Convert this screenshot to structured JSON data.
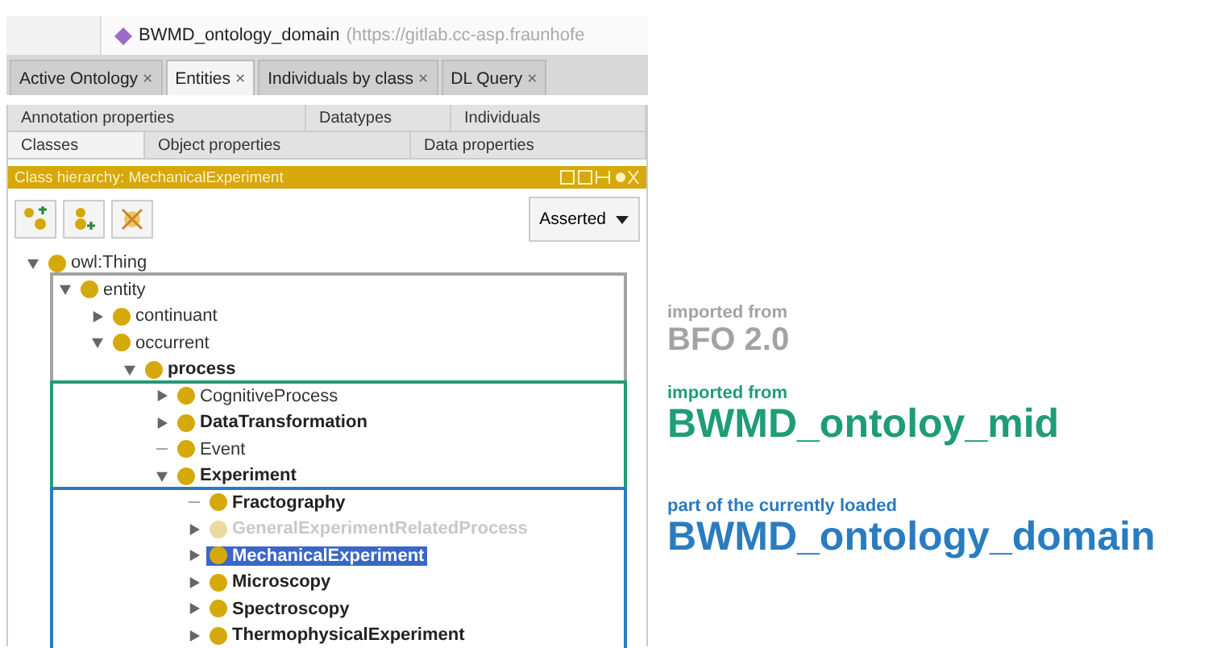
{
  "address_bar": {
    "title": "BWMD_ontology_domain",
    "url": "(https://gitlab.cc-asp.fraunhofe"
  },
  "tabs": [
    {
      "label": "Active Ontology",
      "close": "×",
      "selected": false
    },
    {
      "label": "Entities",
      "close": "×",
      "selected": true
    },
    {
      "label": "Individuals by class",
      "close": "×",
      "selected": false
    },
    {
      "label": "DL Query",
      "close": "×",
      "selected": false
    }
  ],
  "sub_tabs": [
    [
      {
        "label": "Annotation properties",
        "selected": false
      },
      {
        "label": "Datatypes",
        "selected": false
      },
      {
        "label": "Individuals",
        "selected": false
      }
    ],
    [
      {
        "label": "Classes",
        "selected": true
      },
      {
        "label": "Object properties",
        "selected": false
      },
      {
        "label": "Data properties",
        "selected": false
      }
    ]
  ],
  "view_header": {
    "title": "Class hierarchy: MechanicalExperiment"
  },
  "toolbar": {
    "dropdown": "Asserted"
  },
  "tree": [
    {
      "label": "owl:Thing",
      "kind": "branch",
      "expanded": true,
      "bold": false,
      "selected": false,
      "disabled": false,
      "children": [
        {
          "label": "entity",
          "kind": "branch",
          "expanded": true,
          "bold": false,
          "selected": false,
          "disabled": false,
          "children": [
            {
              "label": "continuant",
              "kind": "branch",
              "expanded": false,
              "bold": false,
              "selected": false,
              "disabled": false
            },
            {
              "label": "occurrent",
              "kind": "branch",
              "expanded": true,
              "bold": false,
              "selected": false,
              "disabled": false,
              "children": [
                {
                  "label": "process",
                  "kind": "branch",
                  "expanded": true,
                  "bold": true,
                  "selected": false,
                  "disabled": false,
                  "children": [
                    {
                      "label": "CognitiveProcess",
                      "kind": "branch",
                      "expanded": false,
                      "bold": false,
                      "selected": false,
                      "disabled": false
                    },
                    {
                      "label": "DataTransformation",
                      "kind": "branch",
                      "expanded": false,
                      "bold": true,
                      "selected": false,
                      "disabled": false
                    },
                    {
                      "label": "Event",
                      "kind": "leaf",
                      "bold": false,
                      "selected": false,
                      "disabled": false
                    },
                    {
                      "label": "Experiment",
                      "kind": "branch",
                      "expanded": true,
                      "bold": true,
                      "selected": false,
                      "disabled": false,
                      "children": [
                        {
                          "label": "Fractography",
                          "kind": "leaf",
                          "bold": true,
                          "selected": false,
                          "disabled": false
                        },
                        {
                          "label": "GeneralExperimentRelatedProcess",
                          "kind": "branch",
                          "expanded": false,
                          "bold": true,
                          "selected": false,
                          "disabled": true
                        },
                        {
                          "label": "MechanicalExperiment",
                          "kind": "branch",
                          "expanded": false,
                          "bold": true,
                          "selected": true,
                          "disabled": false
                        },
                        {
                          "label": "Microscopy",
                          "kind": "branch",
                          "expanded": false,
                          "bold": true,
                          "selected": false,
                          "disabled": false
                        },
                        {
                          "label": "Spectroscopy",
                          "kind": "branch",
                          "expanded": false,
                          "bold": true,
                          "selected": false,
                          "disabled": false
                        },
                        {
                          "label": "ThermophysicalExperiment",
                          "kind": "branch",
                          "expanded": false,
                          "bold": true,
                          "selected": false,
                          "disabled": false
                        }
                      ]
                    }
                  ]
                }
              ]
            }
          ]
        }
      ]
    }
  ],
  "annotations": [
    {
      "caption": "imported from",
      "name": "BFO 2.0",
      "color": "#a3a3a3"
    },
    {
      "caption": "imported from",
      "name": "BWMD_ontoloy_mid",
      "color": "#1f9c78"
    },
    {
      "caption": "part of the currently loaded",
      "name": "BWMD_ontology_domain",
      "color": "#2a7cc0"
    }
  ]
}
